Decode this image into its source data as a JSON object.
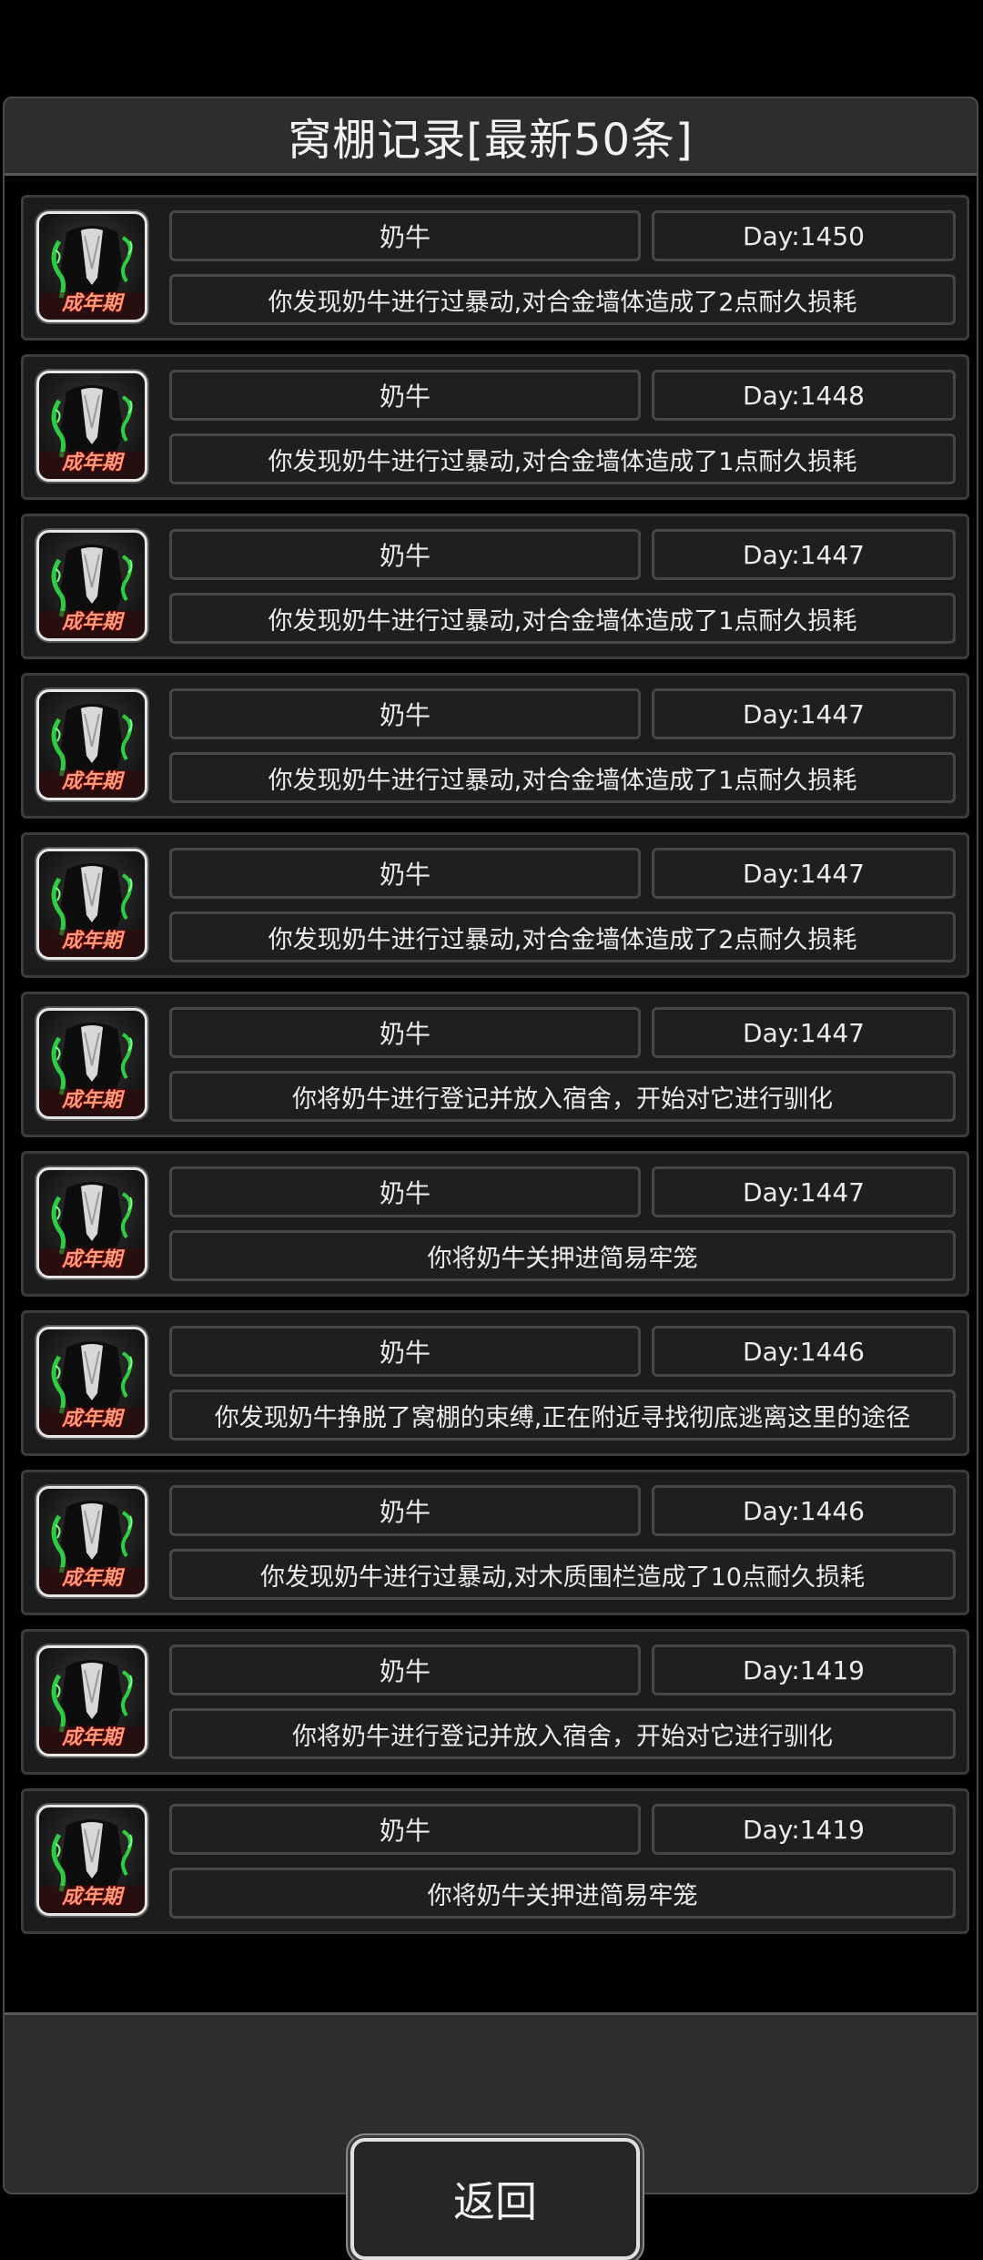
{
  "window": {
    "title": "窝棚记录[最新50条]"
  },
  "records": [
    {
      "name": "奶牛",
      "day": "Day:1450",
      "message": "你发现奶牛进行过暴动,对合金墙体造成了2点耐久损耗",
      "stage": "成年期"
    },
    {
      "name": "奶牛",
      "day": "Day:1448",
      "message": "你发现奶牛进行过暴动,对合金墙体造成了1点耐久损耗",
      "stage": "成年期"
    },
    {
      "name": "奶牛",
      "day": "Day:1447",
      "message": "你发现奶牛进行过暴动,对合金墙体造成了1点耐久损耗",
      "stage": "成年期"
    },
    {
      "name": "奶牛",
      "day": "Day:1447",
      "message": "你发现奶牛进行过暴动,对合金墙体造成了1点耐久损耗",
      "stage": "成年期"
    },
    {
      "name": "奶牛",
      "day": "Day:1447",
      "message": "你发现奶牛进行过暴动,对合金墙体造成了2点耐久损耗",
      "stage": "成年期"
    },
    {
      "name": "奶牛",
      "day": "Day:1447",
      "message": "你将奶牛进行登记并放入宿舍，开始对它进行驯化",
      "stage": "成年期"
    },
    {
      "name": "奶牛",
      "day": "Day:1447",
      "message": "你将奶牛关押进简易牢笼",
      "stage": "成年期"
    },
    {
      "name": "奶牛",
      "day": "Day:1446",
      "message": "你发现奶牛挣脱了窝棚的束缚,正在附近寻找彻底逃离这里的途径",
      "stage": "成年期"
    },
    {
      "name": "奶牛",
      "day": "Day:1446",
      "message": "你发现奶牛进行过暴动,对木质围栏造成了10点耐久损耗",
      "stage": "成年期"
    },
    {
      "name": "奶牛",
      "day": "Day:1419",
      "message": "你将奶牛进行登记并放入宿舍，开始对它进行驯化",
      "stage": "成年期"
    },
    {
      "name": "奶牛",
      "day": "Day:1419",
      "message": "你将奶牛关押进简易牢笼",
      "stage": "成年期"
    }
  ],
  "footer": {
    "back_label": "返回"
  },
  "colors": {
    "background": "#000000",
    "panel": "#2d2d2d",
    "stage_label": "#ff9a7a",
    "avatar_accent": "#2ecc40"
  },
  "icons": {
    "avatar": "cow-portrait-icon"
  }
}
